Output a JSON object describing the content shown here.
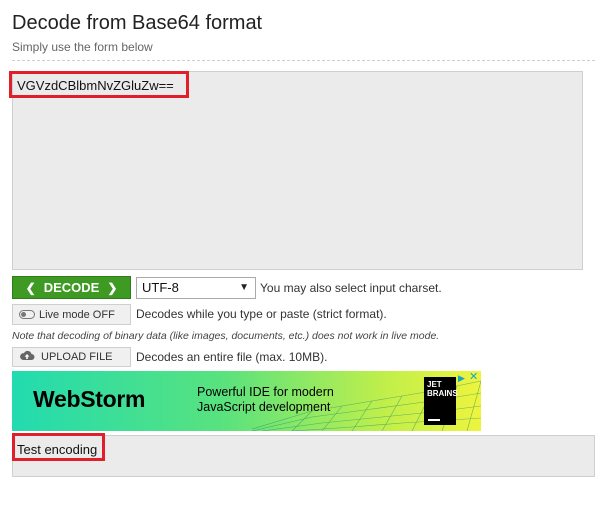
{
  "header": {
    "title": "Decode from Base64 format",
    "subtitle": "Simply use the form below"
  },
  "input": {
    "value": "VGVzdCBlbmNvZGluZw=="
  },
  "decode_button": {
    "label": "DECODE"
  },
  "charset": {
    "selected": "UTF-8",
    "note": "You may also select input charset."
  },
  "live_mode": {
    "label": "Live mode OFF",
    "note": "Decodes while you type or paste (strict format).",
    "binary_note": "Note that decoding of binary data (like images, documents, etc.) does not work in live mode."
  },
  "upload": {
    "label": "UPLOAD FILE",
    "note": "Decodes an entire file (max. 10MB)."
  },
  "ad": {
    "brand": "WebStorm",
    "tagline_line1": "Powerful IDE for modern",
    "tagline_line2": "JavaScript development",
    "logo_line1": "JET",
    "logo_line2": "BRAINS"
  },
  "output": {
    "value": "Test encoding"
  },
  "colors": {
    "decode_green": "#3e9a23",
    "highlight_red": "#e01f2a",
    "textarea_bg": "#ebebeb"
  }
}
